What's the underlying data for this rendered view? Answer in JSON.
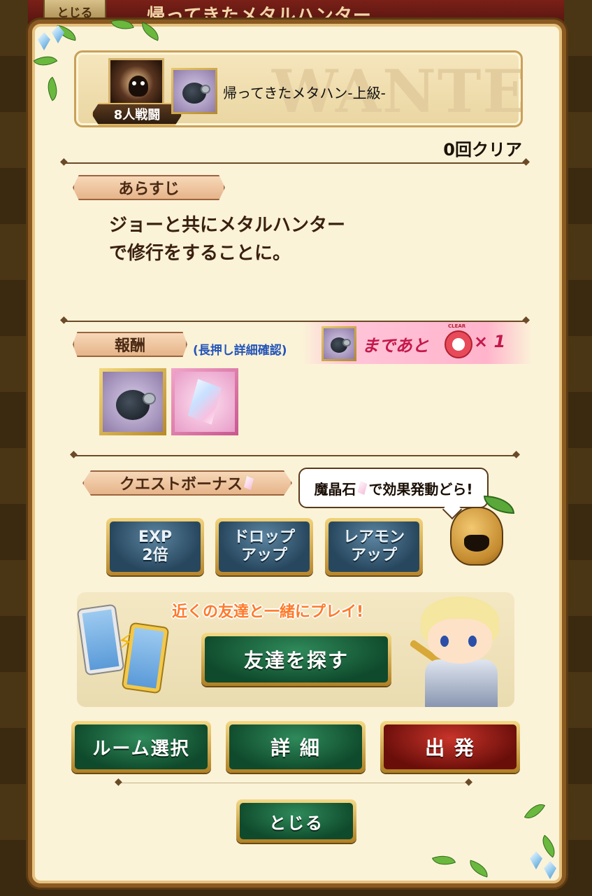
{
  "window": {
    "back_tab": "とじる",
    "title": "帰ってきたメタルハンター"
  },
  "quest": {
    "watermark": "WANTED",
    "battle_type": "8人戦闘",
    "name": "帰ってきたメタハン-上級-",
    "clear_count": "0回クリア"
  },
  "synopsis": {
    "label": "あらすじ",
    "lines": [
      "ジョーと共にメタルハンター",
      "で修行をすることに。"
    ]
  },
  "rewards": {
    "label": "報酬",
    "hint": "(長押し詳細確認)",
    "until_text": "まであと",
    "until_count": "× 1",
    "medal_text": "CLEAR",
    "items": [
      {
        "type": "metal-hunter-item"
      },
      {
        "type": "magic-crystal"
      }
    ]
  },
  "bonus": {
    "label": "クエストボーナス",
    "speech": "魔晶石で効果発動どら!",
    "speech_pre": "魔晶石",
    "speech_post": "で効果発動どら!",
    "buttons": [
      {
        "line1": "EXP",
        "line2": "2倍"
      },
      {
        "line1": "ドロップ",
        "line2": "アップ"
      },
      {
        "line1": "レアモン",
        "line2": "アップ"
      }
    ]
  },
  "friend": {
    "caption": "近くの友達と一緒にプレイ!",
    "button": "友達を探す"
  },
  "actions": {
    "room_select": "ルーム選択",
    "details": "詳 細",
    "depart": "出 発",
    "close": "とじる"
  },
  "colors": {
    "panel_bg": "#fbf3d8",
    "frame": "#8a5a22",
    "green_button": "#0f4a2c",
    "red_button": "#6a0e0a",
    "bonus_button": "#27475e",
    "reward_hint": "#2354b8",
    "until_text": "#c4184c"
  }
}
